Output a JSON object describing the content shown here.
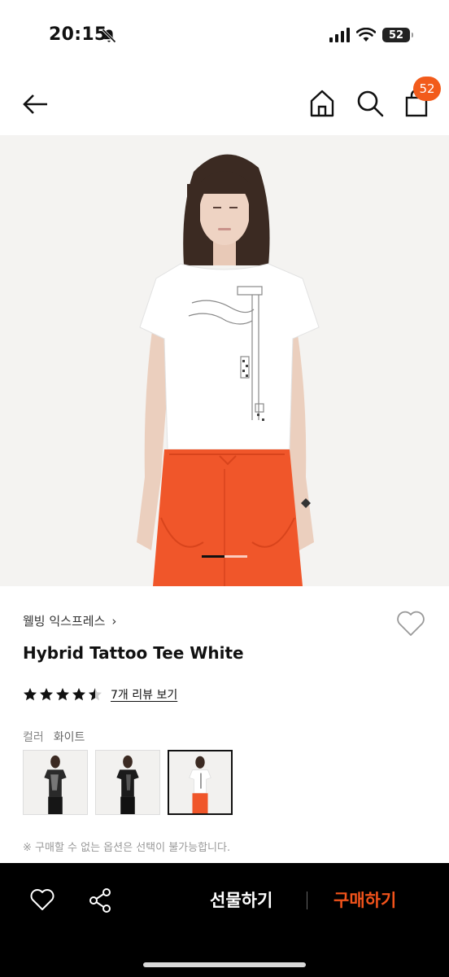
{
  "status_bar": {
    "time": "20:15",
    "battery": "52"
  },
  "nav": {
    "cart_count": "52"
  },
  "product": {
    "brand": "웰빙 익스프레스",
    "brand_chevron": "›",
    "title": "Hybrid Tattoo Tee White",
    "rating": 4.5,
    "rating_max": 5,
    "review_link": "7개 리뷰 보기",
    "color_label": "컬러",
    "color_value": "화이트",
    "image_index": 1,
    "notice": "※ 구매할 수 없는 옵션은 선택이 불가능합니다."
  },
  "bottom_bar": {
    "gift_label": "선물하기",
    "buy_label": "구매하기"
  },
  "icons": {
    "back": "arrow-left-icon",
    "home": "home-icon",
    "search": "search-icon",
    "bag": "shopping-bag-icon",
    "wish": "heart-icon",
    "share": "share-icon",
    "bell_off": "bell-off-icon",
    "signal": "cellular-signal-icon",
    "wifi": "wifi-icon"
  },
  "colors": {
    "accent": "#f25b1b",
    "buy": "#f2531b",
    "bottom_bar_bg": "#000000",
    "skirt": "#f0562a"
  }
}
